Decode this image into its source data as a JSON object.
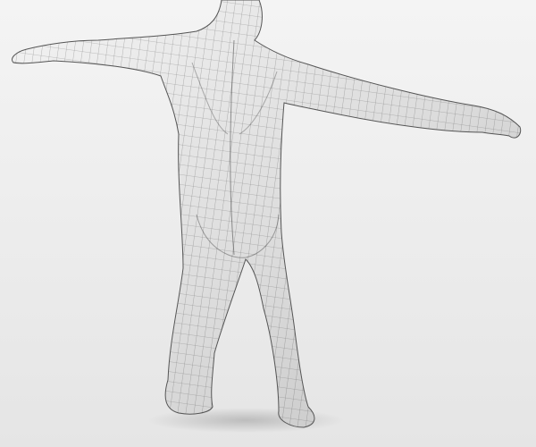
{
  "scene": {
    "subject": "wireframe-human-mesh",
    "colors": {
      "background_top": "#f3f3f3",
      "background_bottom": "#e6e6e6",
      "mesh_fill_light": "#f2f2f2",
      "mesh_fill_dark": "#c4c4c4",
      "wire": "#3a3a3a"
    }
  }
}
